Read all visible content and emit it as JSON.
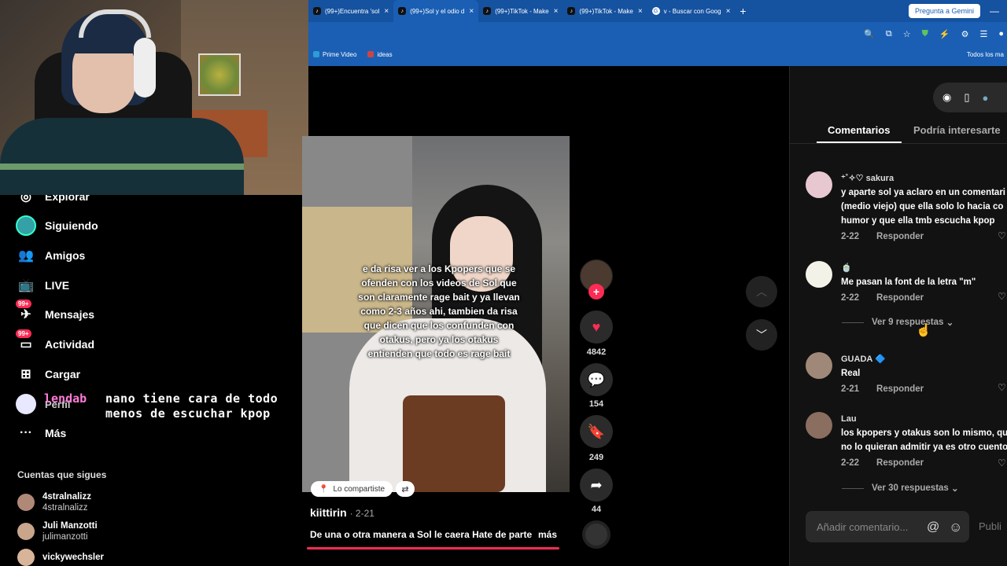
{
  "browser": {
    "tabs": [
      {
        "label": "(99+)Encuentra 'sol"
      },
      {
        "label": "(99+)Sol y el odio d"
      },
      {
        "label": "(99+)TikTok - Make"
      },
      {
        "label": "(99+)TikTok - Make"
      },
      {
        "label": "v - Buscar con Goog"
      }
    ],
    "gemini_label": "Pregunta a Gemini",
    "bookmarks": [
      {
        "label": "Prime Video"
      },
      {
        "label": "ideas"
      }
    ],
    "all_bookmarks": "Todos los ma"
  },
  "sidebar": {
    "items": [
      {
        "label": "Explorar"
      },
      {
        "label": "Siguiendo"
      },
      {
        "label": "Amigos"
      },
      {
        "label": "LIVE"
      },
      {
        "label": "Mensajes",
        "badge": "99+"
      },
      {
        "label": "Actividad",
        "badge": "99+"
      },
      {
        "label": "Cargar"
      },
      {
        "label": "Perfil"
      },
      {
        "label": "Más"
      }
    ],
    "following_title": "Cuentas que sigues",
    "accounts": [
      {
        "name": "4stralnalizz",
        "handle": "4stralnalizz"
      },
      {
        "name": "Juli Manzotti",
        "handle": "julimanzotti"
      },
      {
        "name": "vickywechsler",
        "handle": ""
      }
    ]
  },
  "stream_overlay": {
    "pink_prefix": "lendab",
    "message": "nano tiene cara de todo menos de escuchar kpop"
  },
  "video": {
    "caption": "e da risa ver a los Kpopers que se ofenden con los videos de Sol que son claramente rage bait y ya llevan como 2-3 años ahi, tambien da risa que dicen que los confunden con otakus, pero ya los otakus entienden que todo es rage bait",
    "shared_label": "Lo compartiste",
    "author": "kiittirin",
    "date": "· 2-21",
    "description": "De una o otra manera a Sol le caera Hate de parte",
    "more_label": "más",
    "progress": 0.98,
    "likes": "4842",
    "comments": "154",
    "saves": "249",
    "shares": "44"
  },
  "comments_panel": {
    "tab_comments": "Comentarios",
    "tab_interest": "Podría interesarte",
    "comments": [
      {
        "user": "⁺˚✧♡ sakura",
        "lines": [
          "y aparte sol ya aclaro en un comentari",
          "(medio viejo) que ella solo lo hacia co",
          "humor y que ella tmb escucha kpop"
        ],
        "date": "2-22",
        "reply": "Responder"
      },
      {
        "user": "🍵",
        "lines": [
          "Me pasan la font de la letra \"m\""
        ],
        "date": "2-22",
        "reply": "Responder",
        "more": "Ver 9 respuestas"
      },
      {
        "user": "GUADA 🔷",
        "lines": [
          "Real"
        ],
        "date": "2-21",
        "reply": "Responder"
      },
      {
        "user": "Lau",
        "lines": [
          "los kpopers y otakus son lo mismo, qu",
          "no lo quieran admitir ya es otro cuento"
        ],
        "date": "2-22",
        "reply": "Responder",
        "more": "Ver 30 respuestas"
      }
    ],
    "input_placeholder": "Añadir comentario...",
    "post_label": "Publi"
  },
  "colors": {
    "accent": "#fe2c55",
    "chrome": "#1a5fb4",
    "panel": "#121212"
  }
}
